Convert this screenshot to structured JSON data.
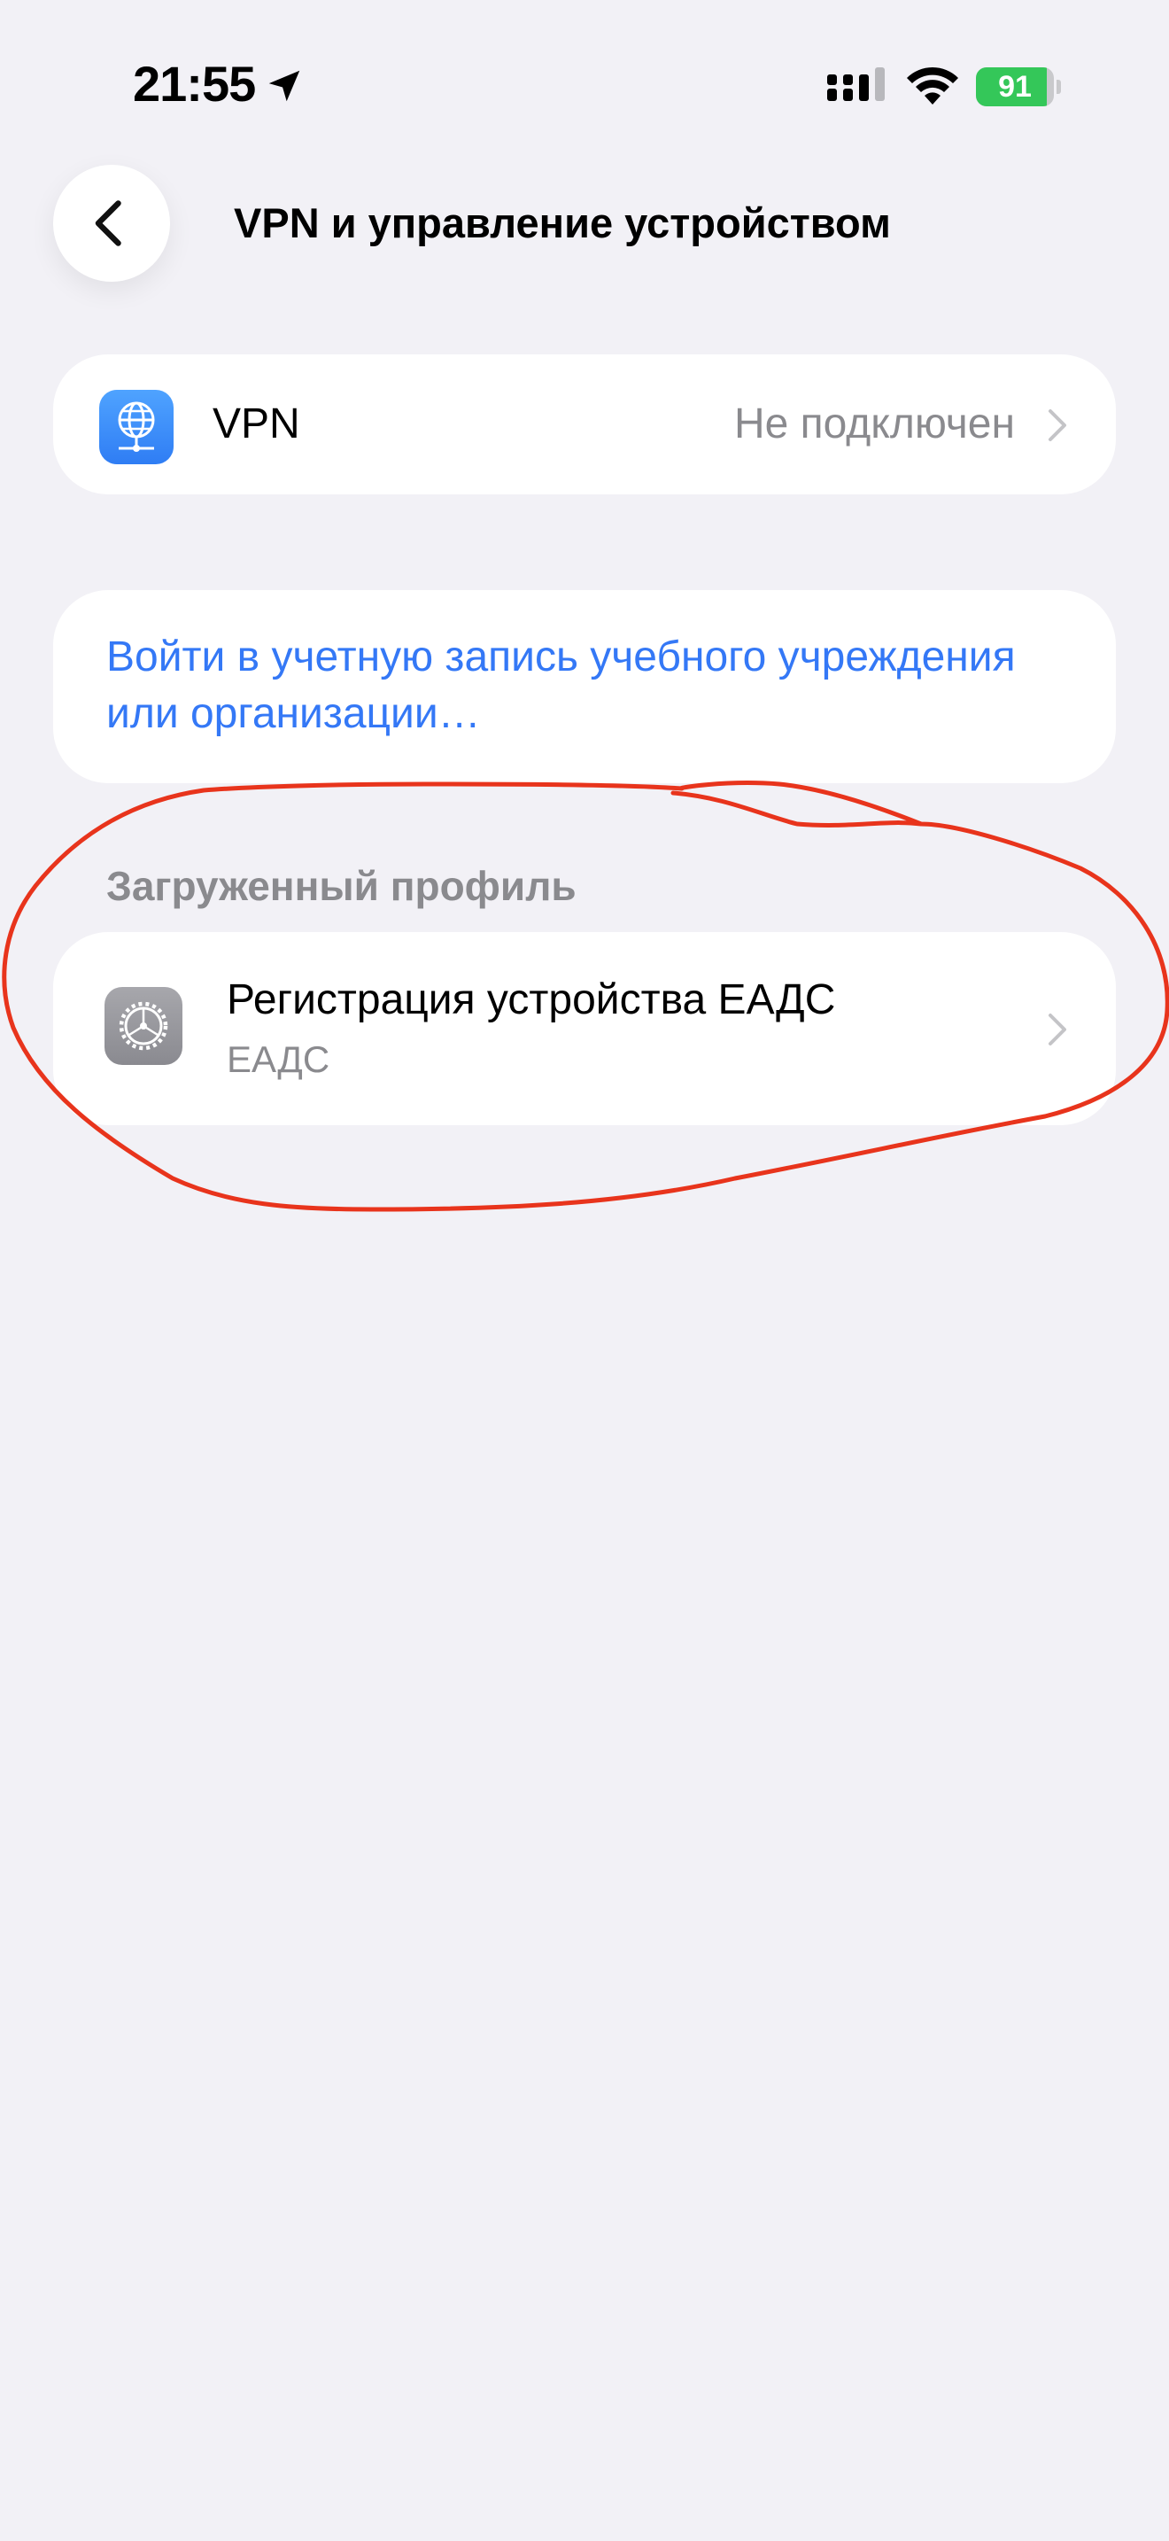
{
  "status_bar": {
    "time": "21:55",
    "battery_percent": 91,
    "battery_label": "91",
    "icons": [
      "location-arrow-icon",
      "cellular-signal-icon",
      "wifi-icon",
      "battery-charging-icon"
    ]
  },
  "nav": {
    "title": "VPN и управление устройством",
    "back_icon": "chevron-left-icon"
  },
  "vpn": {
    "label": "VPN",
    "status": "Не подключен",
    "icon": "vpn-globe-icon"
  },
  "signin": {
    "link": "Войти в учетную запись учебного учреждения или организации…"
  },
  "downloaded_profile": {
    "header": "Загруженный профиль",
    "title": "Регистрация устройства ЕАДС",
    "subtitle": "ЕАДС",
    "icon": "settings-gear-icon"
  },
  "colors": {
    "background": "#f2f1f6",
    "card": "#ffffff",
    "link": "#3478f6",
    "secondary_text": "#8a8a8e",
    "battery_green": "#34c759",
    "annotation_red": "#e8341c"
  }
}
